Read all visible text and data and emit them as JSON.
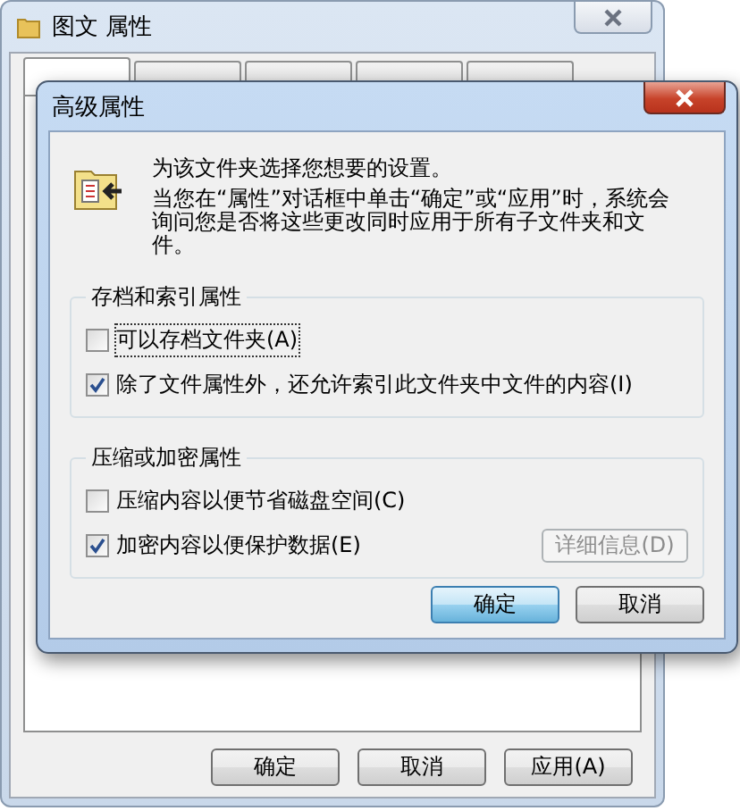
{
  "window": {
    "title": "图文 属性"
  },
  "tabs": [
    {
      "selected": true
    },
    {
      "selected": false
    },
    {
      "selected": false
    },
    {
      "selected": false
    },
    {
      "selected": false
    }
  ],
  "buttons": [
    "确定",
    "取消",
    "应用(A)"
  ],
  "dialog": {
    "title": "高级属性",
    "intro": [
      "为该文件夹选择您想要的设置。",
      "当您在“属性”对话框中单击“确定”或“应用”时，系统会询问您是否将这些更改同时应用于所有子文件夹和文件。"
    ],
    "groups": [
      {
        "legend": "存档和索引属性",
        "options": [
          {
            "label": "可以存档文件夹(A)",
            "checked": false,
            "focused": true
          },
          {
            "label": "除了文件属性外，还允许索引此文件夹中文件的内容(I)",
            "checked": true,
            "focused": false
          }
        ]
      },
      {
        "legend": "压缩或加密属性",
        "options": [
          {
            "label": "压缩内容以便节省磁盘空间(C)",
            "checked": false,
            "focused": false
          },
          {
            "label": "加密内容以便保护数据(E)",
            "checked": true,
            "focused": false
          }
        ],
        "details_button": {
          "label": "详细信息(D)",
          "disabled": true
        }
      }
    ],
    "buttons": [
      {
        "label": "确定",
        "default": true
      },
      {
        "label": "取消",
        "default": false
      }
    ]
  }
}
